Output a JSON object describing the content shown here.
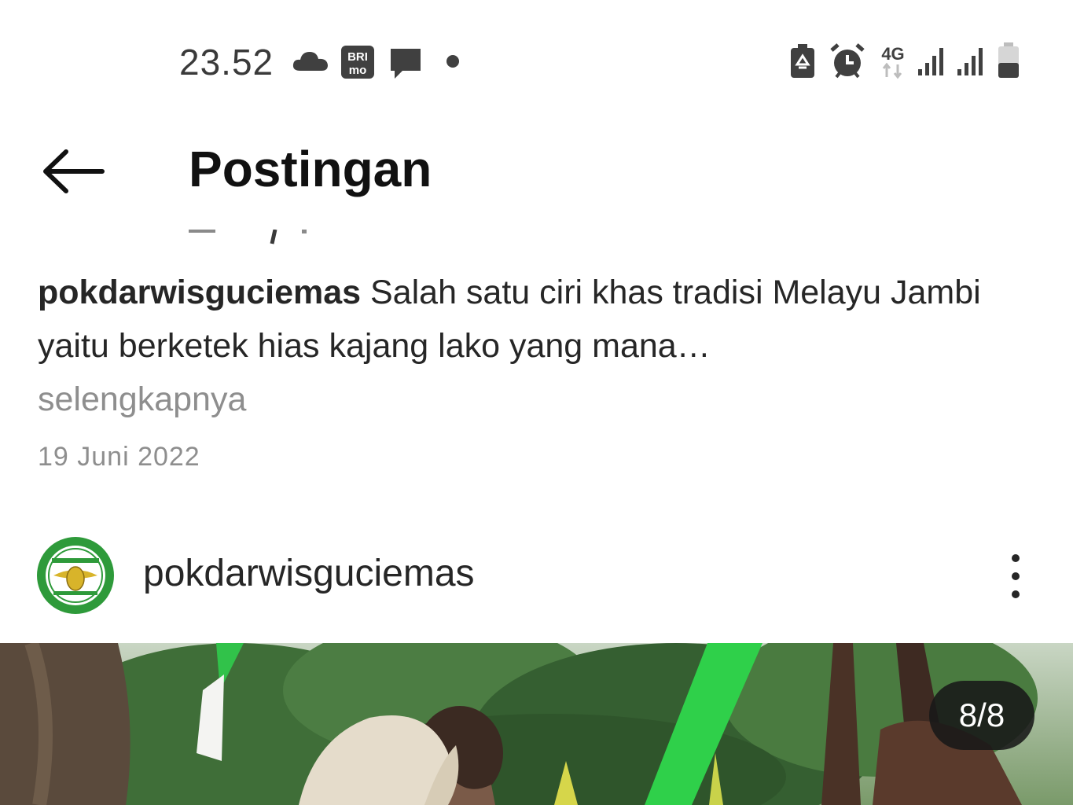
{
  "status_bar": {
    "time": "23.52",
    "left_icons": [
      "cloud-icon",
      "brimo-app-icon",
      "message-icon",
      "dot-icon"
    ],
    "brimo_top": "BRI",
    "brimo_bottom": "mo",
    "network": "4G",
    "right_icons": [
      "battery-saver-icon",
      "alarm-icon",
      "network-4g-icon",
      "signal-icon",
      "signal-icon",
      "battery-icon"
    ]
  },
  "header": {
    "back_icon": "arrow-left-icon",
    "title": "Postingan"
  },
  "prev_post": {
    "username": "pokdarwisguciemas",
    "caption": "Salah satu ciri khas tradisi Melayu Jambi yaitu berketek hias kajang lako yang mana…",
    "more_label": "selengkapnya",
    "date": "19 Juni 2022"
  },
  "post": {
    "username": "pokdarwisguciemas",
    "menu_icon": "more-vertical-icon",
    "avatar_icon": "pokdarwis-logo",
    "image_counter": "8/8"
  },
  "colors": {
    "text": "#262626",
    "secondary": "#8e8e8e",
    "logo_green": "#2e9a3a",
    "logo_gold": "#d8b42a",
    "counter_bg": "#181818"
  }
}
